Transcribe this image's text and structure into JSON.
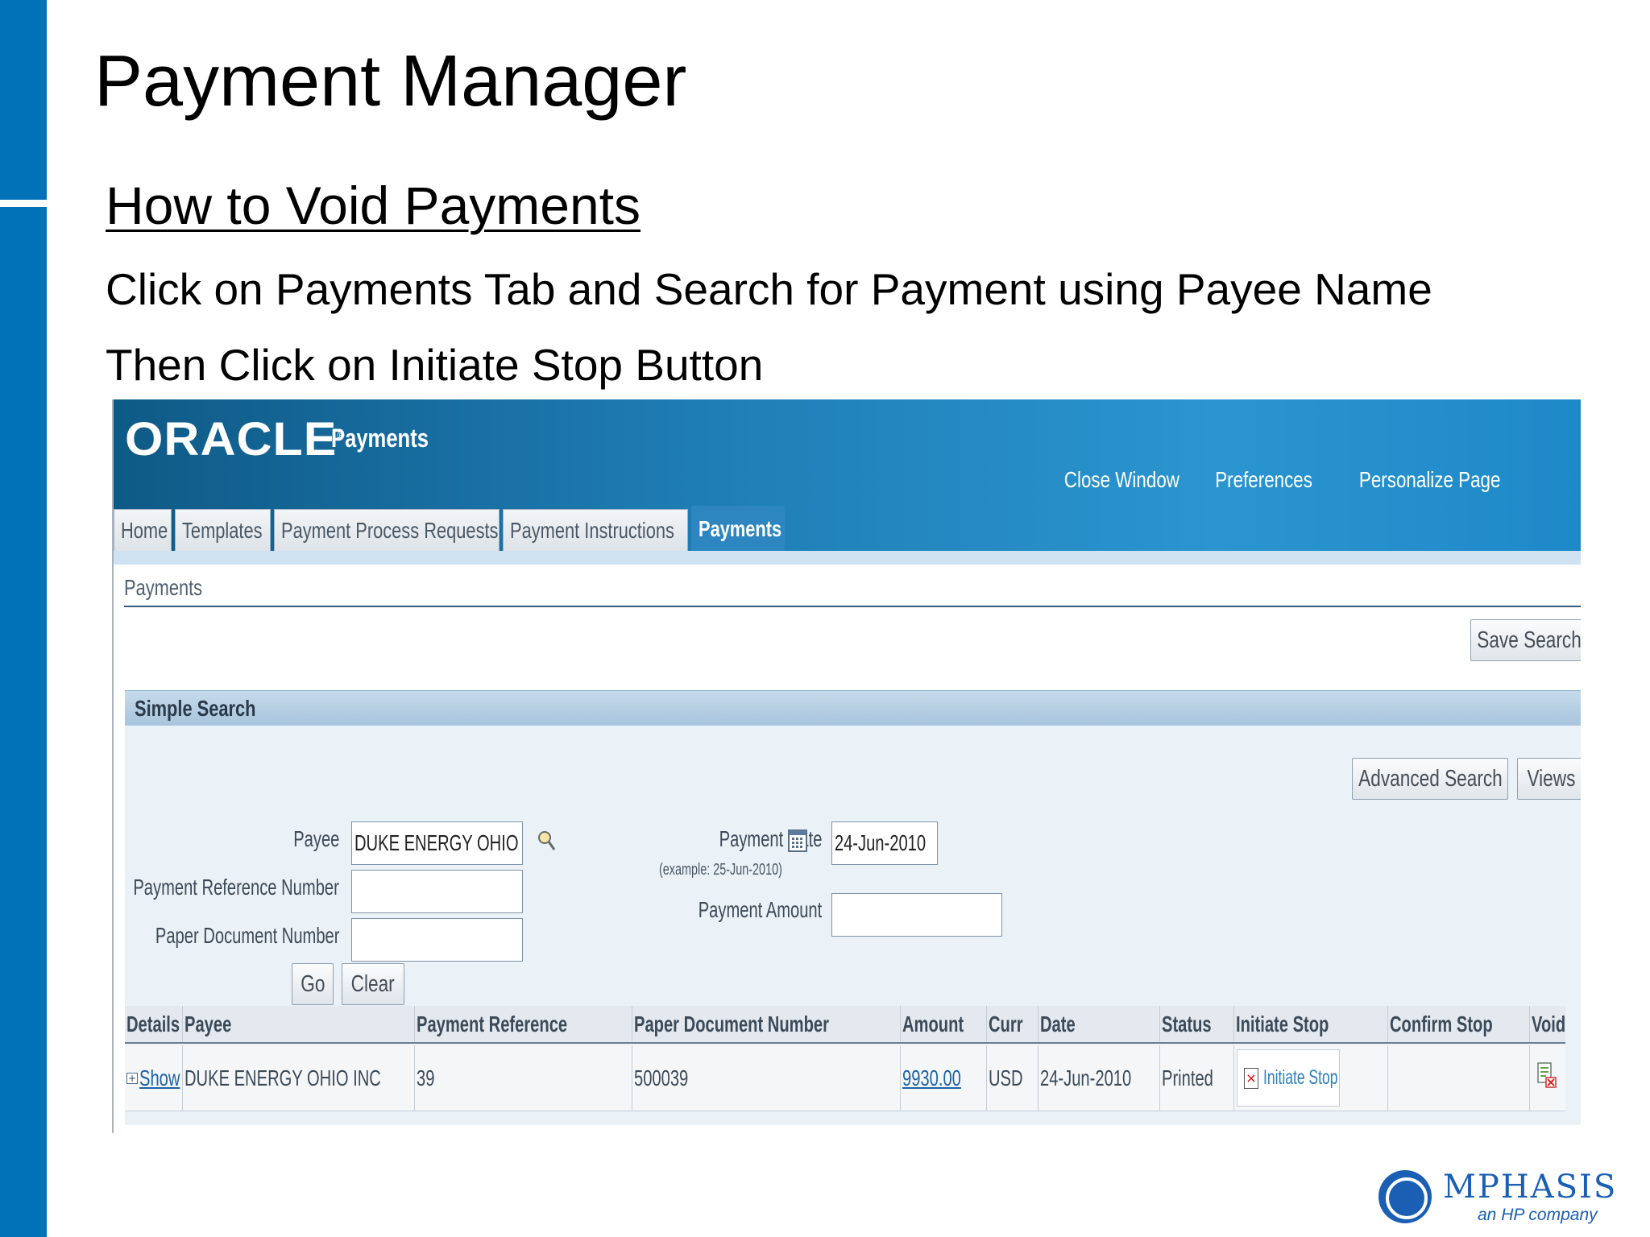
{
  "slide": {
    "title": "Payment Manager",
    "subtitle": "How to Void Payments",
    "instruction_1": "Click on Payments Tab and Search for Payment using Payee Name",
    "instruction_2": "Then Click on Initiate Stop Button"
  },
  "app": {
    "brand": "ORACLE",
    "name": "Payments",
    "global_links": [
      "Close Window",
      "Preferences",
      "Personalize Page"
    ],
    "tabs": [
      {
        "label": "Home",
        "active": false
      },
      {
        "label": "Templates",
        "active": false
      },
      {
        "label": "Payment Process Requests",
        "active": false
      },
      {
        "label": "Payment Instructions",
        "active": false
      },
      {
        "label": "Payments",
        "active": true
      }
    ],
    "page_title": "Payments",
    "save_search_label": "Save Search"
  },
  "search": {
    "header": "Simple Search",
    "advanced_search_label": "Advanced Search",
    "views_label": "Views",
    "payee_label": "Payee",
    "payee_value": "DUKE ENERGY OHIO INC",
    "payment_reference_label": "Payment Reference Number",
    "payment_reference_value": "",
    "paper_document_label": "Paper Document Number",
    "paper_document_value": "",
    "payment_date_label": "Payment Date",
    "payment_date_value": "24-Jun-2010",
    "payment_date_hint": "(example: 25-Jun-2010)",
    "payment_amount_label": "Payment Amount",
    "payment_amount_value": "",
    "go_label": "Go",
    "clear_label": "Clear"
  },
  "results": {
    "headers": [
      "Details",
      "Payee",
      "Payment Reference",
      "Paper Document Number",
      "Amount",
      "Curr",
      "Date",
      "Status",
      "Initiate Stop",
      "Confirm Stop",
      "Void"
    ],
    "rows": [
      {
        "details": "Show",
        "payee": "DUKE ENERGY OHIO INC",
        "payment_reference": "39",
        "paper_document_number": "500039",
        "amount": "9930.00",
        "currency": "USD",
        "date": "24-Jun-2010",
        "status": "Printed",
        "initiate_stop": "Initiate Stop",
        "confirm_stop": ""
      }
    ]
  },
  "footer": {
    "company": "MPHASIS",
    "tagline": "an HP company"
  },
  "colors": {
    "slide_bar": "#0073b8",
    "header_blue": "#1f7db5",
    "link_blue": "#1c63a6"
  }
}
